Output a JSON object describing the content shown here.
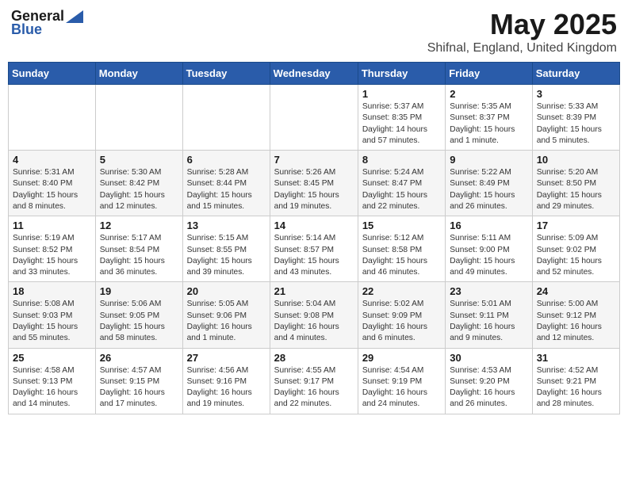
{
  "logo": {
    "general": "General",
    "blue": "Blue"
  },
  "title": "May 2025",
  "location": "Shifnal, England, United Kingdom",
  "days_header": [
    "Sunday",
    "Monday",
    "Tuesday",
    "Wednesday",
    "Thursday",
    "Friday",
    "Saturday"
  ],
  "weeks": [
    [
      {
        "day": "",
        "content": ""
      },
      {
        "day": "",
        "content": ""
      },
      {
        "day": "",
        "content": ""
      },
      {
        "day": "",
        "content": ""
      },
      {
        "day": "1",
        "content": "Sunrise: 5:37 AM\nSunset: 8:35 PM\nDaylight: 14 hours and 57 minutes."
      },
      {
        "day": "2",
        "content": "Sunrise: 5:35 AM\nSunset: 8:37 PM\nDaylight: 15 hours and 1 minute."
      },
      {
        "day": "3",
        "content": "Sunrise: 5:33 AM\nSunset: 8:39 PM\nDaylight: 15 hours and 5 minutes."
      }
    ],
    [
      {
        "day": "4",
        "content": "Sunrise: 5:31 AM\nSunset: 8:40 PM\nDaylight: 15 hours and 8 minutes."
      },
      {
        "day": "5",
        "content": "Sunrise: 5:30 AM\nSunset: 8:42 PM\nDaylight: 15 hours and 12 minutes."
      },
      {
        "day": "6",
        "content": "Sunrise: 5:28 AM\nSunset: 8:44 PM\nDaylight: 15 hours and 15 minutes."
      },
      {
        "day": "7",
        "content": "Sunrise: 5:26 AM\nSunset: 8:45 PM\nDaylight: 15 hours and 19 minutes."
      },
      {
        "day": "8",
        "content": "Sunrise: 5:24 AM\nSunset: 8:47 PM\nDaylight: 15 hours and 22 minutes."
      },
      {
        "day": "9",
        "content": "Sunrise: 5:22 AM\nSunset: 8:49 PM\nDaylight: 15 hours and 26 minutes."
      },
      {
        "day": "10",
        "content": "Sunrise: 5:20 AM\nSunset: 8:50 PM\nDaylight: 15 hours and 29 minutes."
      }
    ],
    [
      {
        "day": "11",
        "content": "Sunrise: 5:19 AM\nSunset: 8:52 PM\nDaylight: 15 hours and 33 minutes."
      },
      {
        "day": "12",
        "content": "Sunrise: 5:17 AM\nSunset: 8:54 PM\nDaylight: 15 hours and 36 minutes."
      },
      {
        "day": "13",
        "content": "Sunrise: 5:15 AM\nSunset: 8:55 PM\nDaylight: 15 hours and 39 minutes."
      },
      {
        "day": "14",
        "content": "Sunrise: 5:14 AM\nSunset: 8:57 PM\nDaylight: 15 hours and 43 minutes."
      },
      {
        "day": "15",
        "content": "Sunrise: 5:12 AM\nSunset: 8:58 PM\nDaylight: 15 hours and 46 minutes."
      },
      {
        "day": "16",
        "content": "Sunrise: 5:11 AM\nSunset: 9:00 PM\nDaylight: 15 hours and 49 minutes."
      },
      {
        "day": "17",
        "content": "Sunrise: 5:09 AM\nSunset: 9:02 PM\nDaylight: 15 hours and 52 minutes."
      }
    ],
    [
      {
        "day": "18",
        "content": "Sunrise: 5:08 AM\nSunset: 9:03 PM\nDaylight: 15 hours and 55 minutes."
      },
      {
        "day": "19",
        "content": "Sunrise: 5:06 AM\nSunset: 9:05 PM\nDaylight: 15 hours and 58 minutes."
      },
      {
        "day": "20",
        "content": "Sunrise: 5:05 AM\nSunset: 9:06 PM\nDaylight: 16 hours and 1 minute."
      },
      {
        "day": "21",
        "content": "Sunrise: 5:04 AM\nSunset: 9:08 PM\nDaylight: 16 hours and 4 minutes."
      },
      {
        "day": "22",
        "content": "Sunrise: 5:02 AM\nSunset: 9:09 PM\nDaylight: 16 hours and 6 minutes."
      },
      {
        "day": "23",
        "content": "Sunrise: 5:01 AM\nSunset: 9:11 PM\nDaylight: 16 hours and 9 minutes."
      },
      {
        "day": "24",
        "content": "Sunrise: 5:00 AM\nSunset: 9:12 PM\nDaylight: 16 hours and 12 minutes."
      }
    ],
    [
      {
        "day": "25",
        "content": "Sunrise: 4:58 AM\nSunset: 9:13 PM\nDaylight: 16 hours and 14 minutes."
      },
      {
        "day": "26",
        "content": "Sunrise: 4:57 AM\nSunset: 9:15 PM\nDaylight: 16 hours and 17 minutes."
      },
      {
        "day": "27",
        "content": "Sunrise: 4:56 AM\nSunset: 9:16 PM\nDaylight: 16 hours and 19 minutes."
      },
      {
        "day": "28",
        "content": "Sunrise: 4:55 AM\nSunset: 9:17 PM\nDaylight: 16 hours and 22 minutes."
      },
      {
        "day": "29",
        "content": "Sunrise: 4:54 AM\nSunset: 9:19 PM\nDaylight: 16 hours and 24 minutes."
      },
      {
        "day": "30",
        "content": "Sunrise: 4:53 AM\nSunset: 9:20 PM\nDaylight: 16 hours and 26 minutes."
      },
      {
        "day": "31",
        "content": "Sunrise: 4:52 AM\nSunset: 9:21 PM\nDaylight: 16 hours and 28 minutes."
      }
    ]
  ]
}
